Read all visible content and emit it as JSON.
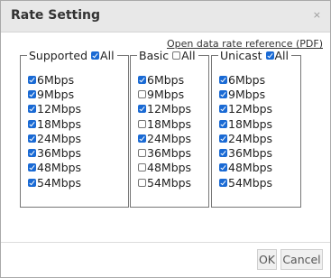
{
  "dialog": {
    "title": "Rate Setting",
    "close_glyph": "×"
  },
  "reference_link": "Open data rate reference (PDF)",
  "groups": [
    {
      "label": "Supported",
      "all_label": "All",
      "all_checked": true,
      "rates": [
        {
          "label": "6Mbps",
          "checked": true
        },
        {
          "label": "9Mbps",
          "checked": true
        },
        {
          "label": "12Mbps",
          "checked": true
        },
        {
          "label": "18Mbps",
          "checked": true
        },
        {
          "label": "24Mbps",
          "checked": true
        },
        {
          "label": "36Mbps",
          "checked": true
        },
        {
          "label": "48Mbps",
          "checked": true
        },
        {
          "label": "54Mbps",
          "checked": true
        }
      ]
    },
    {
      "label": "Basic",
      "all_label": "All",
      "all_checked": false,
      "rates": [
        {
          "label": "6Mbps",
          "checked": true
        },
        {
          "label": "9Mbps",
          "checked": false
        },
        {
          "label": "12Mbps",
          "checked": true
        },
        {
          "label": "18Mbps",
          "checked": false
        },
        {
          "label": "24Mbps",
          "checked": true
        },
        {
          "label": "36Mbps",
          "checked": false
        },
        {
          "label": "48Mbps",
          "checked": false
        },
        {
          "label": "54Mbps",
          "checked": false
        }
      ]
    },
    {
      "label": "Unicast",
      "all_label": "All",
      "all_checked": true,
      "rates": [
        {
          "label": "6Mbps",
          "checked": true
        },
        {
          "label": "9Mbps",
          "checked": true
        },
        {
          "label": "12Mbps",
          "checked": true
        },
        {
          "label": "18Mbps",
          "checked": true
        },
        {
          "label": "24Mbps",
          "checked": true
        },
        {
          "label": "36Mbps",
          "checked": true
        },
        {
          "label": "48Mbps",
          "checked": true
        },
        {
          "label": "54Mbps",
          "checked": true
        }
      ]
    }
  ],
  "buttons": {
    "ok_label": "OK",
    "cancel_label": "Cancel"
  },
  "colors": {
    "checkbox_checked": "#1a6ad4",
    "titlebar_bg": "#e8e8e8"
  }
}
